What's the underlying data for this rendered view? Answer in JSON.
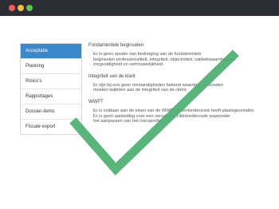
{
  "window": {
    "controls": [
      "close",
      "minimize",
      "maximize"
    ]
  },
  "sidebar": {
    "items": [
      {
        "label": "Acceptatie",
        "active": true
      },
      {
        "label": "Planning",
        "active": false
      },
      {
        "label": "Risico's",
        "active": false
      },
      {
        "label": "Rapportages",
        "active": false
      },
      {
        "label": "Dossier-items",
        "active": false
      },
      {
        "label": "Fiscale export",
        "active": false
      }
    ]
  },
  "sections": [
    {
      "title": "Fundamentele beginselen",
      "text": "Er is geen sprake van bedreiging van de fundamentele\nbeginselen professionaliteit, integriteit, objectiviteit, vakbekwaamheid en\nzorgvuldigheid en vertrouwelijkheid."
    },
    {
      "title": "Integriteit van de klant",
      "text": "Er zijn bij ons geen omstandigheden bekend waardoor wij zouden\nmoeten twijfelen aan de integriteit van de cliënt."
    },
    {
      "title": "WWFT",
      "text": "Er is voldaan aan de eisen van de WWFT. Cliëntonderzoek heeft plaatsgevonden.\nEr is geen aanleiding voor een verscherpt cliëntonderzoek waaronder\nhet aanpassen van het risicoprofiel."
    }
  ],
  "colors": {
    "titlebar": "#2b2d33",
    "active_nav": "#3a87c9",
    "checkmark": "#4caf72"
  },
  "overlay": {
    "icon": "large-checkmark-icon"
  }
}
